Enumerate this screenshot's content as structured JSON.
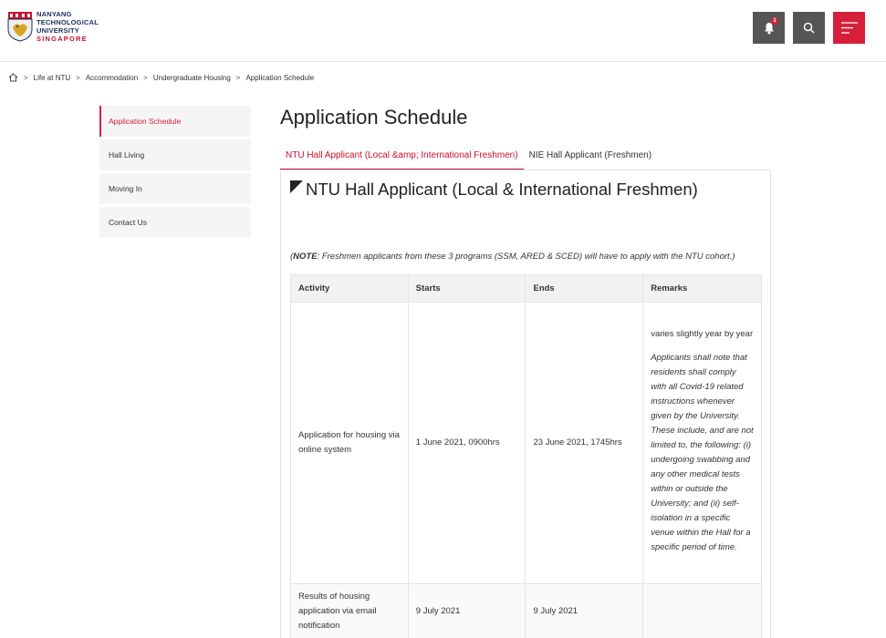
{
  "header": {
    "logo": {
      "line1": "NANYANG",
      "line2": "TECHNOLOGICAL",
      "line3": "UNIVERSITY",
      "line4": "SINGAPORE"
    },
    "notification_count": "1",
    "icons": [
      "bell-icon",
      "search-icon",
      "menu-icon"
    ]
  },
  "breadcrumb": {
    "home_icon": "home-icon",
    "items": [
      "Life at NTU",
      "Accommodation",
      "Undergraduate Housing",
      "Application Schedule"
    ],
    "separator": ">"
  },
  "sidebar": {
    "items": [
      {
        "label": "Application Schedule",
        "active": true
      },
      {
        "label": "Hall Living",
        "active": false
      },
      {
        "label": "Moving In",
        "active": false
      },
      {
        "label": "Contact Us",
        "active": false
      }
    ]
  },
  "main": {
    "title": "Application Schedule",
    "tabs": [
      {
        "label": "NTU Hall Applicant (Local &amp; International Freshmen)",
        "active": true
      },
      {
        "label": "NIE Hall Applicant (Freshmen)",
        "active": false
      }
    ],
    "section_title": "NTU Hall Applicant (Local & International Freshmen)",
    "note": {
      "open": "(",
      "bold": "NOTE",
      "rest": ": Freshmen applicants from these 3 programs (SSM, ARED & SCED) will have to apply with the NTU cohort.)"
    },
    "table": {
      "headers": [
        "Activity",
        "Starts",
        "Ends",
        "Remarks"
      ],
      "rows": [
        {
          "activity": "Application for housing via online system",
          "starts": "1 June 2021, 0900hrs",
          "ends": "23 June 2021, 1745hrs",
          "remark_plain": "varies slightly year by year",
          "remark_italic": "Applicants shall note that residents shall comply with all Covid-19 related instructions whenever given by the University. These include, and are not limited to, the following: (i) undergoing swabbing and any other medical tests within or outside the University; and (ii) self-isolation in a specific venue within the Hall for a specific period of time."
        },
        {
          "activity": "Results of housing application via email notification",
          "starts": "9 July 2021",
          "ends": "9 July 2021",
          "remark_plain": "",
          "remark_italic": ""
        }
      ]
    }
  },
  "colors": {
    "accent": "#d71f3a",
    "dark_button": "#555555",
    "sidebar_bg": "#f5f5f5"
  }
}
